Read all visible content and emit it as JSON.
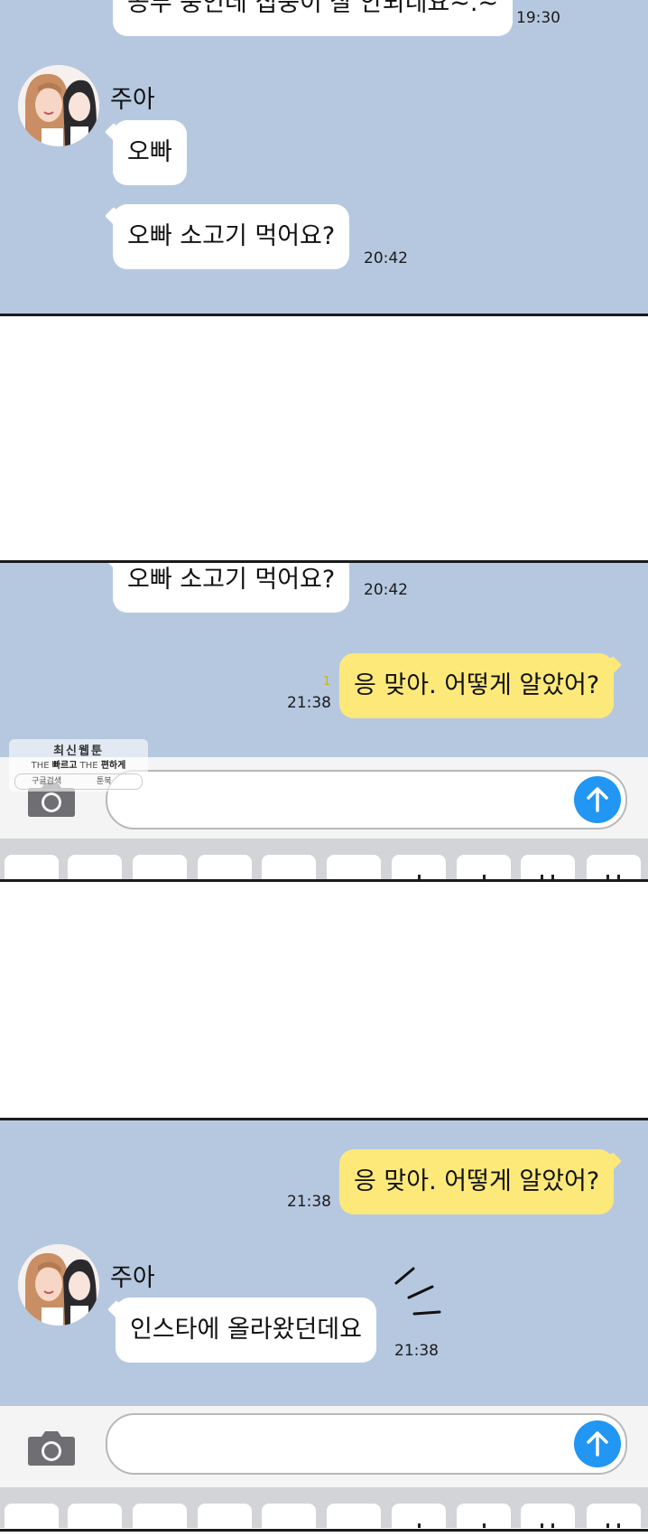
{
  "colors": {
    "chat_background": "#b6c8e0",
    "my_bubble": "#fde97a",
    "their_bubble": "#ffffff",
    "send_button": "#2196f3",
    "unread_count": "#c8b800"
  },
  "panel1": {
    "partial_message": {
      "text": "공부 중인데 집중이 잘 안되네요~.~",
      "time": "19:30"
    },
    "sender_name": "주아",
    "messages": [
      {
        "text": "오빠",
        "time": ""
      },
      {
        "text": "오빠 소고기 먹어요?",
        "time": "20:42"
      }
    ]
  },
  "panel2": {
    "their_message": {
      "text": "오빠 소고기 먹어요?",
      "time": "20:42"
    },
    "my_message": {
      "text": "응 맞아. 어떻게 알았어?",
      "time": "21:38",
      "unread": "1"
    },
    "watermark": {
      "title": "최신웹툰",
      "tagline_the1": "THE",
      "tagline_word1": "빠르고",
      "tagline_the2": "THE",
      "tagline_word2": "편하게",
      "google": "구글검색",
      "toonbook": "툰북"
    }
  },
  "panel3": {
    "my_message": {
      "text": "응 맞아. 어떻게 알았어?",
      "time": "21:38"
    },
    "sender_name": "주아",
    "their_message": {
      "text": "인스타에 올라왔던데요",
      "time": "21:38"
    }
  },
  "input_bar": {
    "placeholder": "",
    "camera_icon": "camera-icon",
    "send_icon": "arrow-up-icon"
  }
}
